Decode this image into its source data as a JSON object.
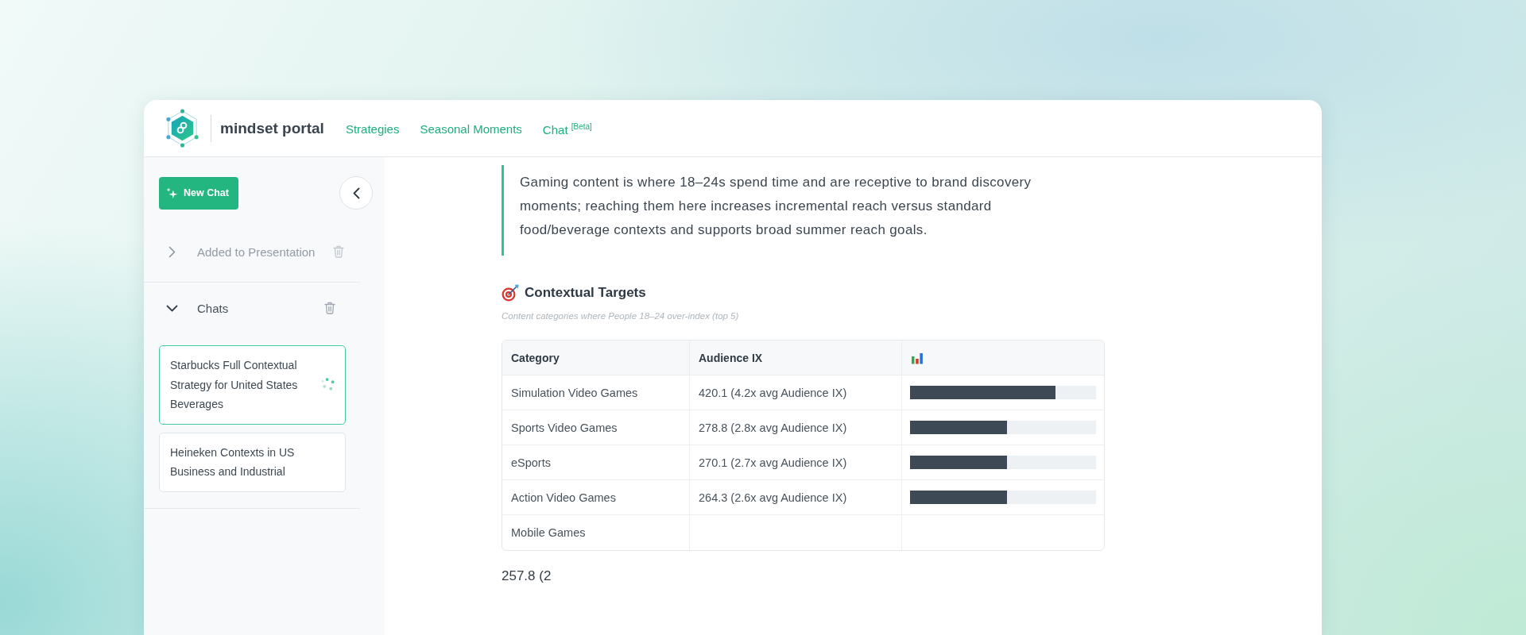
{
  "header": {
    "brand": "mindset portal",
    "nav": [
      {
        "label": "Strategies",
        "selected": false
      },
      {
        "label": "Seasonal Moments",
        "selected": false
      },
      {
        "label": "Chat $^{[Beta]}$",
        "selected": false
      }
    ]
  },
  "sidebar": {
    "new_chat_button": "New Chat",
    "sections": [
      {
        "label": "Added to Presentation",
        "expanded": false
      },
      {
        "label": "Chats",
        "expanded": true,
        "chats": [
          {
            "title": "Starbucks Full Contextual Strategy for United States Beverages",
            "selected": true,
            "loading": true
          },
          {
            "title": "Heineken Contexts in US Business and Industrial",
            "selected": false,
            "loading": false
          }
        ]
      }
    ]
  },
  "content": {
    "quote": "Gaming content is where 18–24s spend time and are receptive to brand discovery moments; reaching them here increases incremental reach versus standard food/beverage contexts and supports broad summer reach goals.",
    "section_title": "Contextual Targets",
    "section_subtitle": "Content categories where People 18–24 over-index (top 5)",
    "table": {
      "columns": [
        {
          "kind": "text",
          "label": "Category"
        },
        {
          "kind": "text",
          "label": "Audience IX"
        },
        {
          "kind": "icon"
        }
      ],
      "rows": [
        {
          "category": "Simulation Video Games",
          "audience_ix": "420.1 (4.2x avg Audience IX)",
          "level": 0.78
        },
        {
          "category": "Sports Video Games",
          "audience_ix": "278.8 (2.8x avg Audience IX)",
          "level": 0.52
        },
        {
          "category": "eSports",
          "audience_ix": "270.1 (2.7x avg Audience IX)",
          "level": 0.52
        },
        {
          "category": "Action Video Games",
          "audience_ix": "264.3 (2.6x avg Audience IX)",
          "level": 0.52
        },
        {
          "category": "Mobile Games"
        }
      ]
    },
    "trailing_text": "257.8 (2"
  }
}
